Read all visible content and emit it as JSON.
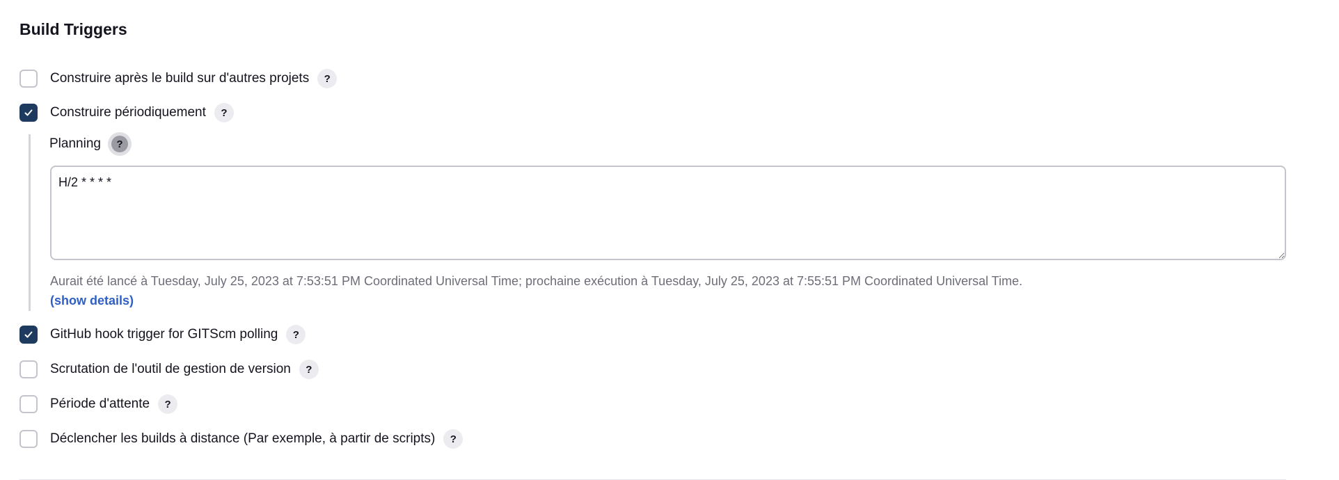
{
  "section": {
    "title": "Build Triggers"
  },
  "options": [
    {
      "label": "Construire après le build sur d'autres projets",
      "checked": false
    },
    {
      "label": "Construire périodiquement",
      "checked": true
    },
    {
      "label": "GitHub hook trigger for GITScm polling",
      "checked": true
    },
    {
      "label": "Scrutation de l'outil de gestion de version",
      "checked": false
    },
    {
      "label": "Période d'attente",
      "checked": false
    },
    {
      "label": "Déclencher les builds à distance (Par exemple, à partir de scripts)",
      "checked": false
    }
  ],
  "help_label": "?",
  "schedule": {
    "label": "Planning",
    "value": "H/2 * * * *",
    "hint": "Aurait été lancé à Tuesday, July 25, 2023 at 7:53:51 PM Coordinated Universal Time; prochaine exécution à Tuesday, July 25, 2023 at 7:55:51 PM Coordinated Universal Time.",
    "show_details": "(show details)"
  },
  "colors": {
    "checked_fill": "#1e3a5f",
    "link": "#2f5fc4",
    "hint_text": "#6d6d78"
  }
}
